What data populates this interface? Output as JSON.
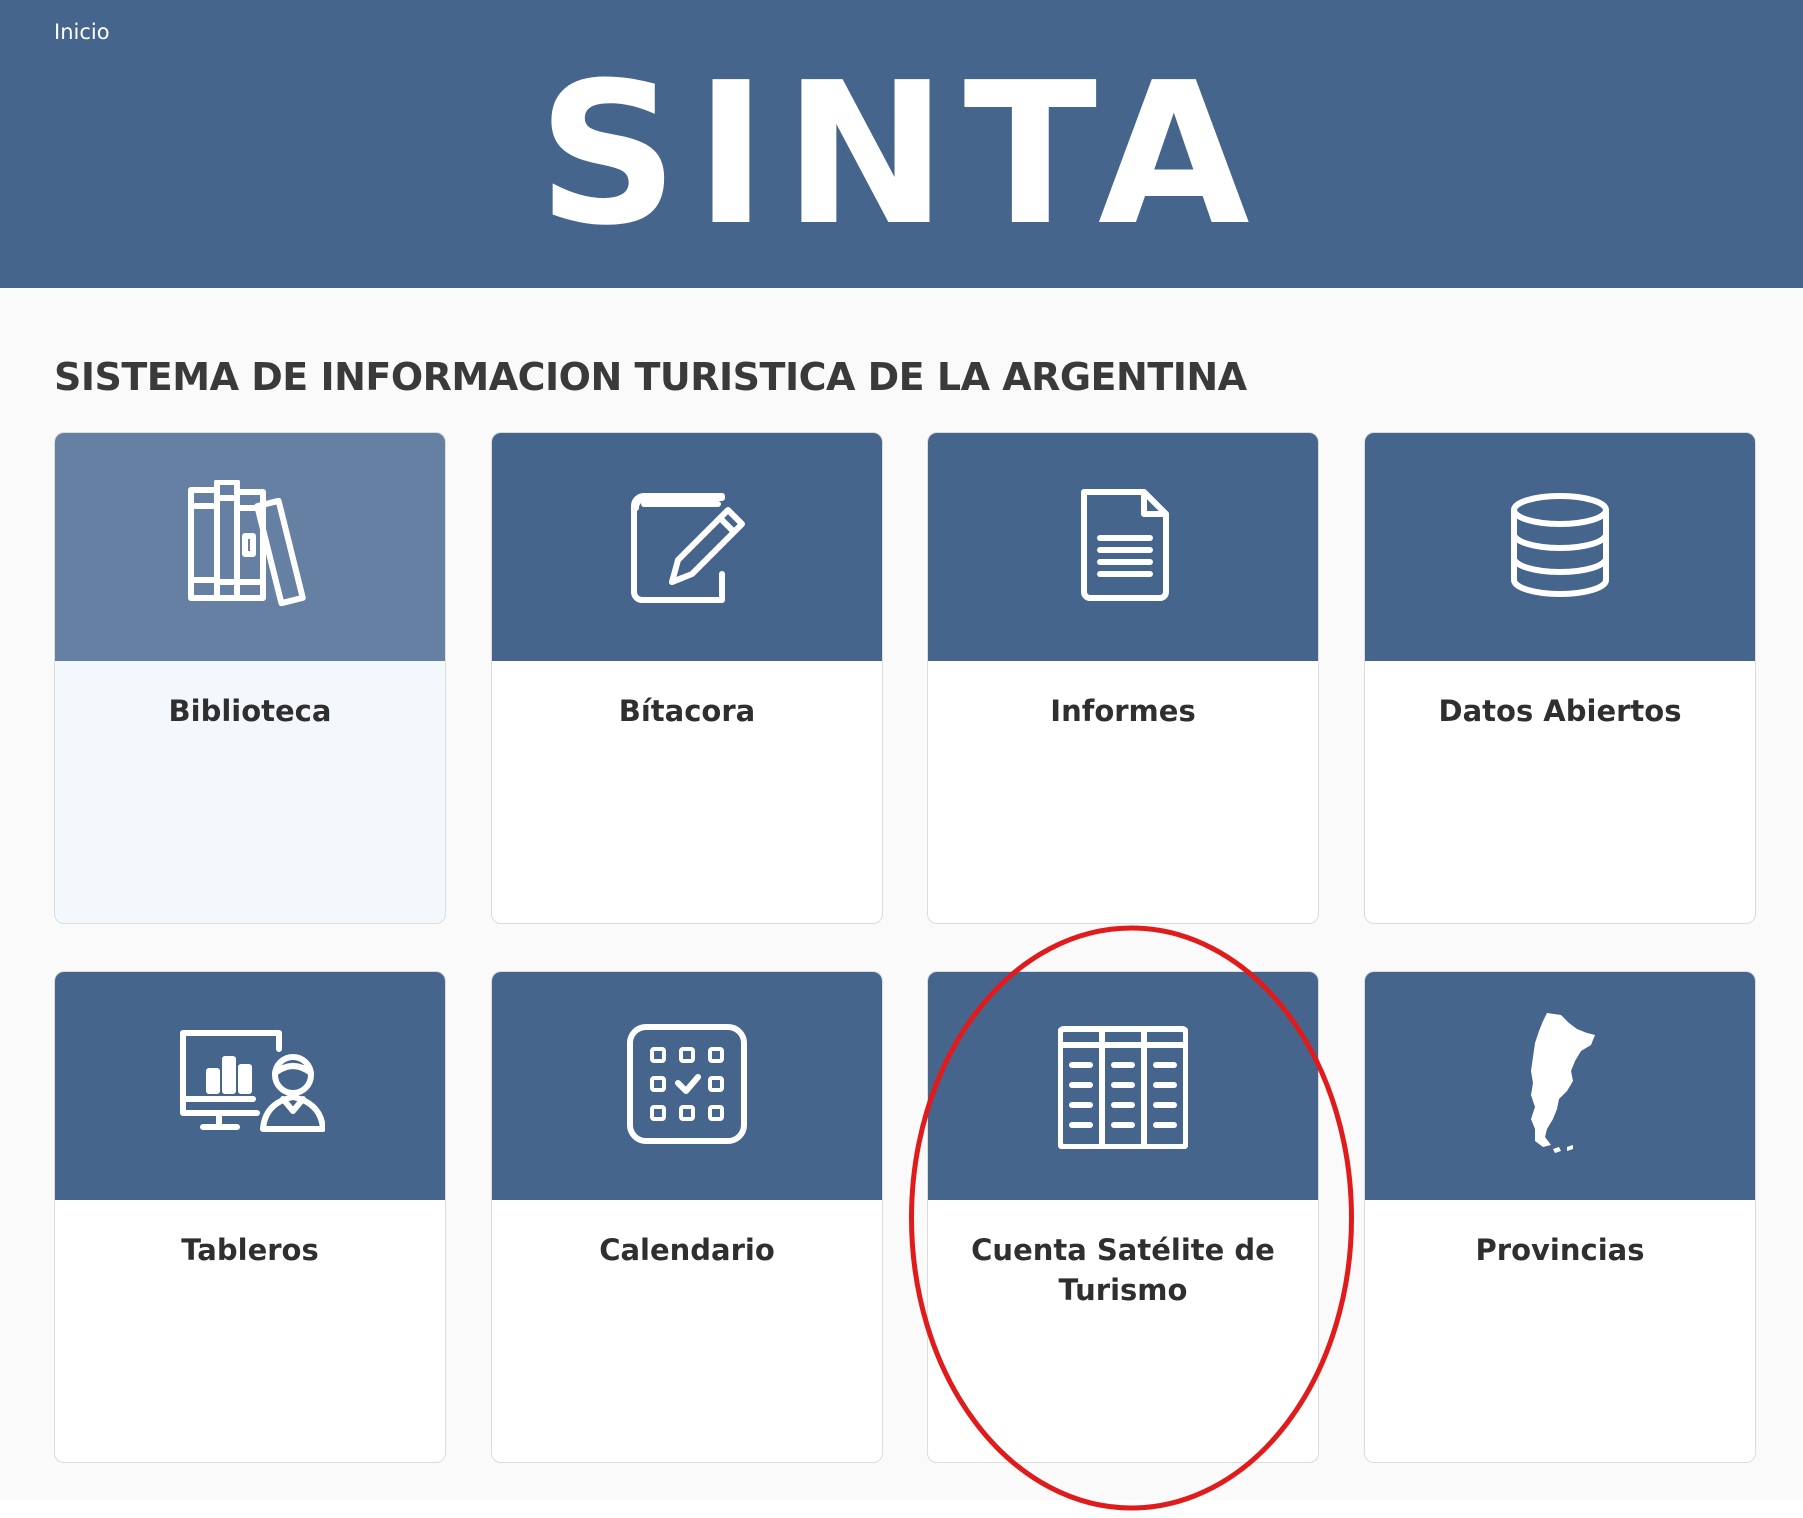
{
  "header": {
    "breadcrumb": "Inicio",
    "brand": "SINTA",
    "background_color": "#46658c"
  },
  "main": {
    "subtitle": "SISTEMA DE INFORMACION TURISTICA DE LA ARGENTINA",
    "cards": [
      {
        "label": "Biblioteca",
        "icon": "books-icon",
        "state": "hover"
      },
      {
        "label": "Bítacora",
        "icon": "notebook-pencil-icon"
      },
      {
        "label": "Informes",
        "icon": "document-icon"
      },
      {
        "label": "Datos Abiertos",
        "icon": "database-icon"
      },
      {
        "label": "Tableros",
        "icon": "dashboard-presenter-icon"
      },
      {
        "label": "Calendario",
        "icon": "calendar-icon"
      },
      {
        "label": "Cuenta Satélite de Turismo",
        "icon": "table-grid-icon",
        "annotated": true
      },
      {
        "label": "Provincias",
        "icon": "argentina-map-icon"
      }
    ]
  },
  "annotation": {
    "shape": "ellipse",
    "color": "#e01b1b",
    "target": "Cuenta Satélite de Turismo"
  }
}
